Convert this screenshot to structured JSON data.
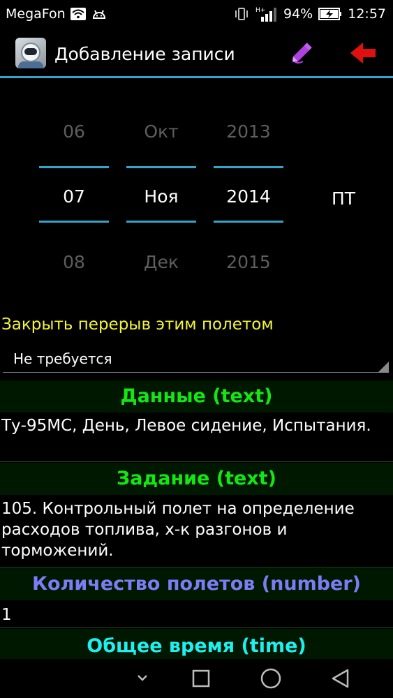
{
  "status_bar": {
    "carrier": "MegaFon",
    "battery": "94%",
    "time": "12:57"
  },
  "action_bar": {
    "title": "Добавление записи",
    "icons": [
      "app-pilot-icon",
      "edit-pencil-icon",
      "back-arrow-icon"
    ],
    "colors": {
      "accent": "#35a4c9",
      "pencil": "#b040e0",
      "arrow": "#e01010"
    }
  },
  "date_picker": {
    "day": {
      "prev": "06",
      "current": "07",
      "next": "08"
    },
    "month": {
      "prev": "Окт",
      "current": "Ноя",
      "next": "Дек"
    },
    "year": {
      "prev": "2013",
      "current": "2014",
      "next": "2015"
    },
    "weekday": "ПТ"
  },
  "break_field": {
    "label": "Закрыть перерыв этим полетом",
    "value": "Не требуется"
  },
  "sections": [
    {
      "title": "Данные (text)",
      "color": "#14e614",
      "value": "Ту-95МС, День, Левое сидение, Испытания."
    },
    {
      "title": "Задание (text)",
      "color": "#14e614",
      "value": "105. Контрольный полет на определение расходов топлива, х-к разгонов и торможений."
    },
    {
      "title": "Количество полетов (number)",
      "color": "#7c7cf5",
      "value": "1"
    },
    {
      "title": "Общее время (time)",
      "color": "#1ef0f0"
    }
  ]
}
